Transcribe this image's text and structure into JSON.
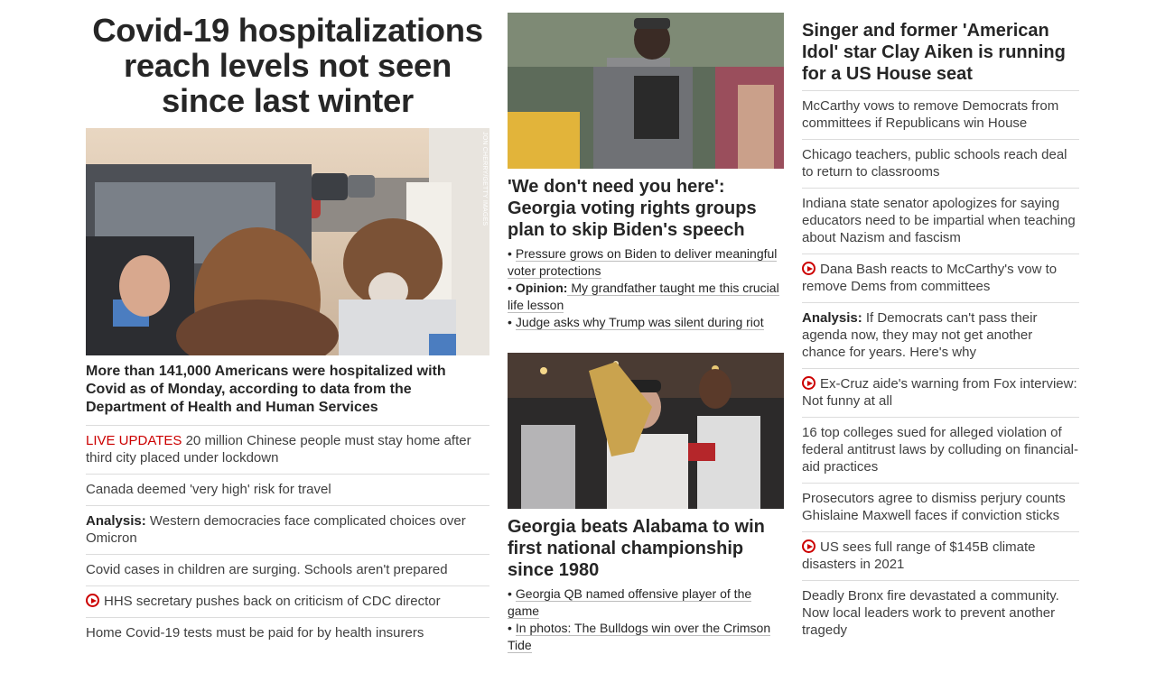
{
  "left": {
    "hero_title": "Covid-19 hospitalizations reach levels not seen since last winter",
    "image_credit": "JON CHERRY/GETTY IMAGES",
    "lead_text": "More than 141,000 Americans were hospitalized with Covid as of Monday, according to data from the Department of Health and Human Services",
    "items": [
      {
        "prefix": "LIVE UPDATES",
        "text": " 20 million Chinese people must stay home after third city placed under lockdown"
      },
      {
        "text": "Canada deemed 'very high' risk for travel"
      },
      {
        "bold": "Analysis:",
        "text": " Western democracies face complicated choices over Omicron"
      },
      {
        "text": "Covid cases in children are surging. Schools aren't prepared"
      },
      {
        "video": true,
        "text": "HHS secretary pushes back on criticism of CDC director"
      },
      {
        "text": "Home Covid-19 tests must be paid for by health insurers"
      }
    ]
  },
  "mid": {
    "story1": {
      "headline": "'We don't need you here': Georgia voting rights groups plan to skip Biden's speech",
      "bullets": [
        {
          "text": "Pressure grows on Biden to deliver meaningful voter protections"
        },
        {
          "bold": "Opinion:",
          "text": " My grandfather taught me this crucial life lesson"
        },
        {
          "text": "Judge asks why Trump was silent during riot"
        }
      ]
    },
    "story2": {
      "headline": "Georgia beats Alabama to win first national championship since 1980",
      "bullets": [
        {
          "text": "Georgia QB named offensive player of the game"
        },
        {
          "text": "In photos: The Bulldogs win over the Crimson Tide"
        }
      ]
    }
  },
  "right": {
    "headline": "Singer and former 'American Idol' star Clay Aiken is running for a US House seat",
    "items": [
      {
        "text": "McCarthy vows to remove Democrats from committees if Republicans win House"
      },
      {
        "text": "Chicago teachers, public schools reach deal to return to classrooms"
      },
      {
        "text": "Indiana state senator apologizes for saying educators need to be impartial when teaching about Nazism and fascism"
      },
      {
        "video": true,
        "text": "Dana Bash reacts to McCarthy's vow to remove Dems from committees"
      },
      {
        "bold": "Analysis:",
        "text": " If Democrats can't pass their agenda now, they may not get another chance for years. Here's why"
      },
      {
        "video": true,
        "text": "Ex-Cruz aide's warning from Fox interview: Not funny at all"
      },
      {
        "text": "16 top colleges sued for alleged violation of federal antitrust laws by colluding on financial-aid practices"
      },
      {
        "text": "Prosecutors agree to dismiss perjury counts Ghislaine Maxwell faces if conviction sticks"
      },
      {
        "video": true,
        "text": "US sees full range of $145B climate disasters in 2021"
      },
      {
        "text": "Deadly Bronx fire devastated a community. Now local leaders work to prevent another tragedy"
      }
    ]
  },
  "colors": {
    "text": "#262626",
    "live": "#cc0000",
    "divider": "#dcdcdc"
  }
}
